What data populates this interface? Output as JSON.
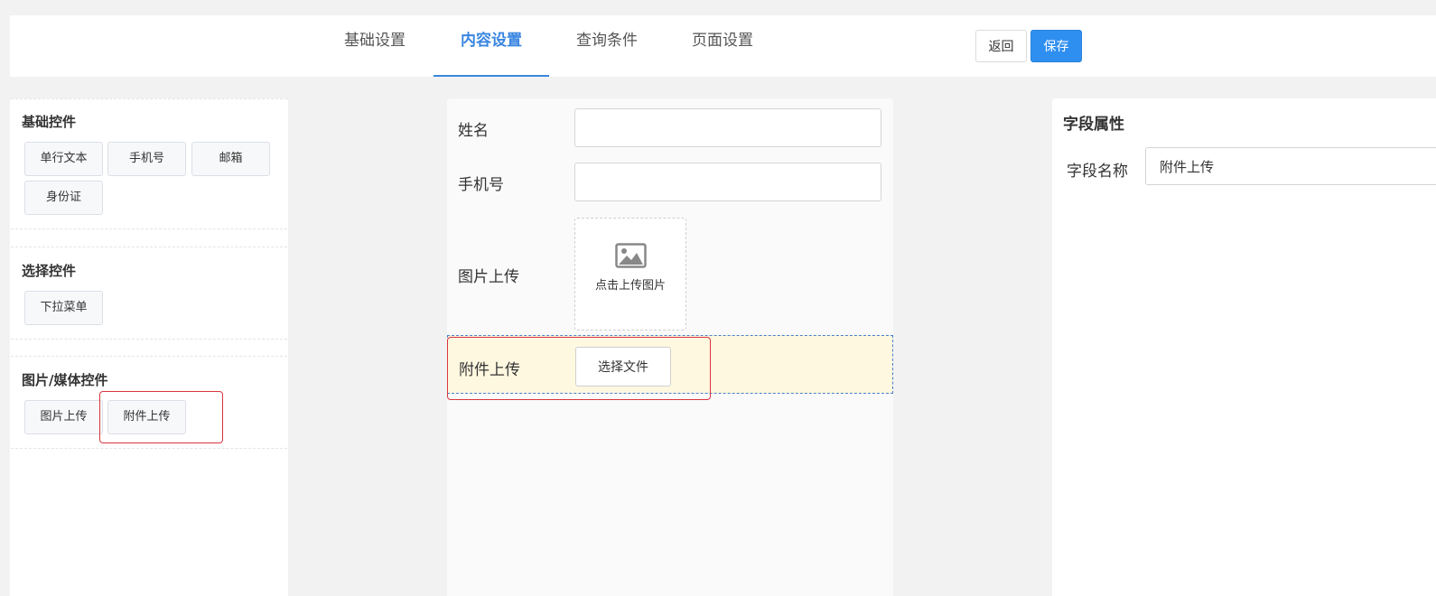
{
  "tabs": [
    {
      "label": "基础设置",
      "active": false
    },
    {
      "label": "内容设置",
      "active": true
    },
    {
      "label": "查询条件",
      "active": false
    },
    {
      "label": "页面设置",
      "active": false
    }
  ],
  "actions": {
    "back_label": "返回",
    "save_label": "保存"
  },
  "palette": {
    "groups": [
      {
        "title": "基础控件",
        "items": [
          "单行文本",
          "手机号",
          "邮箱",
          "身份证"
        ]
      },
      {
        "title": "选择控件",
        "items": [
          "下拉菜单"
        ]
      },
      {
        "title": "图片/媒体控件",
        "items": [
          "图片上传",
          "附件上传"
        ]
      }
    ]
  },
  "form": {
    "name_label": "姓名",
    "phone_label": "手机号",
    "image_label": "图片上传",
    "image_hint": "点击上传图片",
    "attachment_label": "附件上传",
    "choose_file_label": "选择文件"
  },
  "properties": {
    "title": "字段属性",
    "field_name_label": "字段名称",
    "field_name_value": "附件上传"
  },
  "colors": {
    "accent": "#3a86e0",
    "primary_button": "#2f8ff0",
    "selected_row_bg": "#fff8e0",
    "highlight_border": "#d9363e"
  },
  "icons": [
    "image-icon"
  ]
}
